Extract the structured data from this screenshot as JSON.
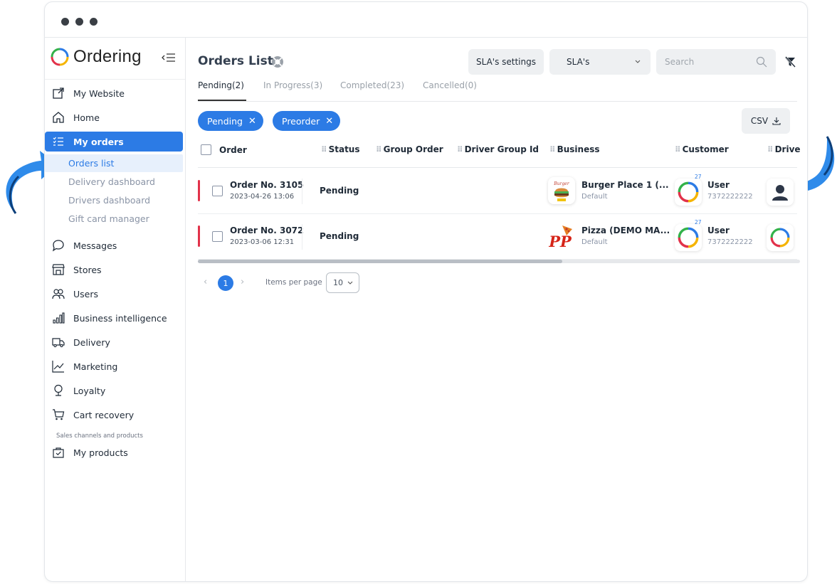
{
  "brand": {
    "name": "Ordering"
  },
  "sidebar": {
    "items": [
      {
        "label": "My Website",
        "icon": "external-link-icon"
      },
      {
        "label": "Home",
        "icon": "home-icon"
      },
      {
        "label": "My orders",
        "icon": "list-icon",
        "active": true
      },
      {
        "label": "Messages",
        "icon": "chat-bubble-icon"
      },
      {
        "label": "Stores",
        "icon": "store-icon"
      },
      {
        "label": "Users",
        "icon": "users-icon"
      },
      {
        "label": "Business intelligence",
        "icon": "bar-chart-icon"
      },
      {
        "label": "Delivery",
        "icon": "truck-icon"
      },
      {
        "label": "Marketing",
        "icon": "trend-line-icon"
      },
      {
        "label": "Loyalty",
        "icon": "award-icon"
      },
      {
        "label": "Cart recovery",
        "icon": "cart-icon"
      },
      {
        "label": "My products",
        "icon": "bag-check-icon"
      }
    ],
    "subitems": [
      {
        "label": "Orders list",
        "active": true
      },
      {
        "label": "Delivery dashboard"
      },
      {
        "label": "Drivers dashboard"
      },
      {
        "label": "Gift card manager"
      }
    ],
    "section_label": "Sales channels and products"
  },
  "header": {
    "title": "Orders List",
    "sla_settings": "SLA's settings",
    "sla_select": "SLA's",
    "search_placeholder": "Search"
  },
  "tabs": [
    {
      "label": "Pending(2)",
      "active": true
    },
    {
      "label": "In Progress(3)"
    },
    {
      "label": "Completed(23)"
    },
    {
      "label": "Cancelled(0)"
    }
  ],
  "chips": [
    "Pending",
    "Preorder"
  ],
  "csv_label": "CSV",
  "table": {
    "columns": [
      "Order",
      "Status",
      "Group Order",
      "Driver Group Id",
      "Business",
      "Customer",
      "Drive"
    ],
    "rows": [
      {
        "order_no": "Order No. 3105",
        "date": "2023-04-26 13:06",
        "status": "Pending",
        "business": "Burger Place 1 (...",
        "business_sub": "Default",
        "badge": "27",
        "customer": "User",
        "phone": "7372222222"
      },
      {
        "order_no": "Order No. 3072",
        "date": "2023-03-06 12:31",
        "status": "Pending",
        "business": "Pizza (DEMO MA...",
        "business_sub": "Default",
        "badge": "27",
        "customer": "User",
        "phone": "7372222222"
      }
    ]
  },
  "pagination": {
    "current_page": "1",
    "items_per_page_label": "Items per page",
    "items_per_page": "10"
  },
  "colors": {
    "accent": "#2c7be5",
    "pending_bar": "#e2324a",
    "arrow": "#2f8bea"
  }
}
